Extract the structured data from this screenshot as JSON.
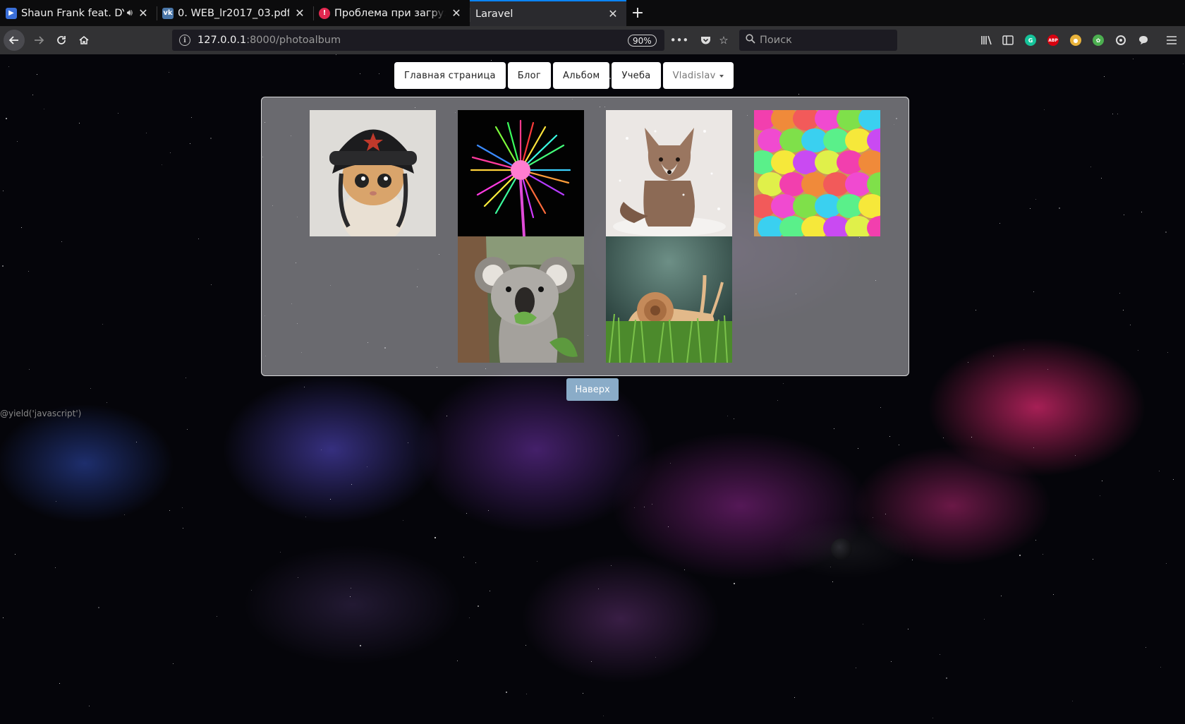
{
  "browser": {
    "tabs": [
      {
        "title": "Shaun Frank feat. DYSON",
        "favicon": "video-player-icon",
        "favicon_color": "#3a6fd8",
        "has_sound": true,
        "active": false
      },
      {
        "title": "0. WEB_lr2017_03.pdf",
        "favicon": "vk-icon",
        "favicon_color": "#4a76a8",
        "has_sound": false,
        "active": false
      },
      {
        "title": "Проблема при загрузке страницы",
        "favicon": "error-icon",
        "favicon_color": "#e22850",
        "has_sound": false,
        "active": false
      },
      {
        "title": "Laravel",
        "favicon": "",
        "favicon_color": "",
        "has_sound": false,
        "active": true
      }
    ],
    "url": {
      "host": "127.0.0.1",
      "path": ":8000/photoalbum"
    },
    "zoom": "90%",
    "search_placeholder": "Поиск",
    "extensions": [
      {
        "name": "grammarly-icon",
        "color": "#15c39a",
        "label": "G"
      },
      {
        "name": "adblock-plus-icon",
        "color": "#d7000f",
        "label": "ABP"
      },
      {
        "name": "tampermonkey-icon",
        "color": "#e8b23b",
        "label": ""
      },
      {
        "name": "green-ext-icon",
        "color": "#4caf50",
        "label": ""
      },
      {
        "name": "sync-icon",
        "color": "#cfcfcf",
        "label": ""
      },
      {
        "name": "chat-icon",
        "color": "#cfcfcf",
        "label": ""
      }
    ]
  },
  "page": {
    "menu": [
      {
        "label": "Главная страница"
      },
      {
        "label": "Блог"
      },
      {
        "label": "Альбом"
      },
      {
        "label": "Учеба"
      }
    ],
    "user_menu": {
      "label": "Vladislav"
    },
    "photos": [
      {
        "name": "photo-cat-in-hat",
        "description": "kitten wearing a soviet ushanka hat"
      },
      {
        "name": "photo-rainbow-dandelion",
        "description": "neon rainbow dandelion on black"
      },
      {
        "name": "photo-snow-fox",
        "description": "fox sitting in falling snow"
      },
      {
        "name": "photo-colored-chicks",
        "description": "pile of dyed colorful chicks"
      },
      {
        "name": "photo-koala",
        "description": "koala eating a leaf"
      },
      {
        "name": "photo-snail",
        "description": "snail on green grass"
      }
    ],
    "to_top_button": "Наверх",
    "debug_text": "@yield('javascript')"
  },
  "colors": {
    "tab_active_accent": "#0a84ff",
    "to_top_button": "#8aacc8",
    "album_panel": "rgba(190,190,195,0.55)"
  }
}
